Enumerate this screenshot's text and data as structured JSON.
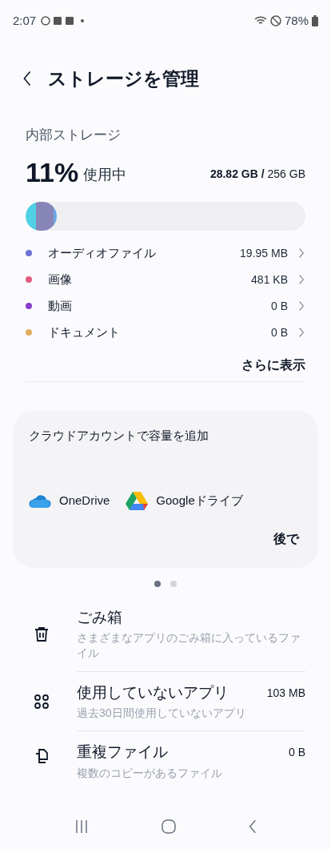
{
  "status_bar": {
    "time": "2:07",
    "battery": "78%"
  },
  "header": {
    "title": "ストレージを管理"
  },
  "storage": {
    "label": "内部ストレージ",
    "percent": "11%",
    "percent_suffix": "使用中",
    "used": "28.82 GB",
    "separator": "/",
    "total": "256 GB",
    "usage_bar": {
      "level": 0.11
    },
    "categories": [
      {
        "name": "オーディオファイル",
        "size": "19.95 MB",
        "color": "#6b6fd6"
      },
      {
        "name": "画像",
        "size": "481 KB",
        "color": "#e05a7c"
      },
      {
        "name": "動画",
        "size": "0 B",
        "color": "#8a3fc8"
      },
      {
        "name": "ドキュメント",
        "size": "0 B",
        "color": "#e0b060"
      }
    ],
    "more_button": "さらに表示"
  },
  "cloud_card": {
    "title": "クラウドアカウントで容量を追加",
    "services": [
      {
        "kind": "onedrive",
        "label": "OneDrive"
      },
      {
        "kind": "gdrive",
        "label": "Googleドライブ"
      }
    ],
    "later_button": "後で"
  },
  "pager": [
    {
      "selected": true
    },
    {
      "selected": false
    }
  ],
  "items": [
    {
      "kind": "trash",
      "title": "ごみ箱",
      "subtitle": "さまざまなアプリのごみ箱に入っているファイル"
    },
    {
      "kind": "apps",
      "title": "使用していないアプリ",
      "subtitle": "過去30日間使用していないアプリ",
      "size": "103 MB"
    },
    {
      "kind": "duplicates",
      "title": "重複ファイル",
      "subtitle": "複数のコピーがあるファイル",
      "size": "0 B"
    }
  ]
}
